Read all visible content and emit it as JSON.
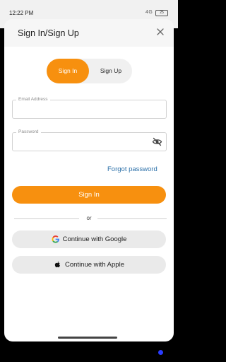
{
  "status_bar": {
    "time": "12:22 PM",
    "signal": "4G",
    "battery": "25"
  },
  "sheet": {
    "title": "Sign In/Sign Up"
  },
  "tabs": {
    "sign_in": "Sign In",
    "sign_up": "Sign Up",
    "selected": "Sign In"
  },
  "form": {
    "email": {
      "label": "Email Address",
      "value": ""
    },
    "password": {
      "label": "Password",
      "value": ""
    },
    "forgot_password": "Forgot password",
    "submit_label": "Sign In"
  },
  "divider_text": "or",
  "social": {
    "google": "Continue with Google",
    "apple": "Continue with Apple"
  },
  "colors": {
    "accent": "#f7900f",
    "link": "#2a6fa8",
    "button_grey": "#eaeaea"
  },
  "icons": [
    "close-icon",
    "eye-off-icon",
    "google-icon",
    "apple-icon"
  ]
}
